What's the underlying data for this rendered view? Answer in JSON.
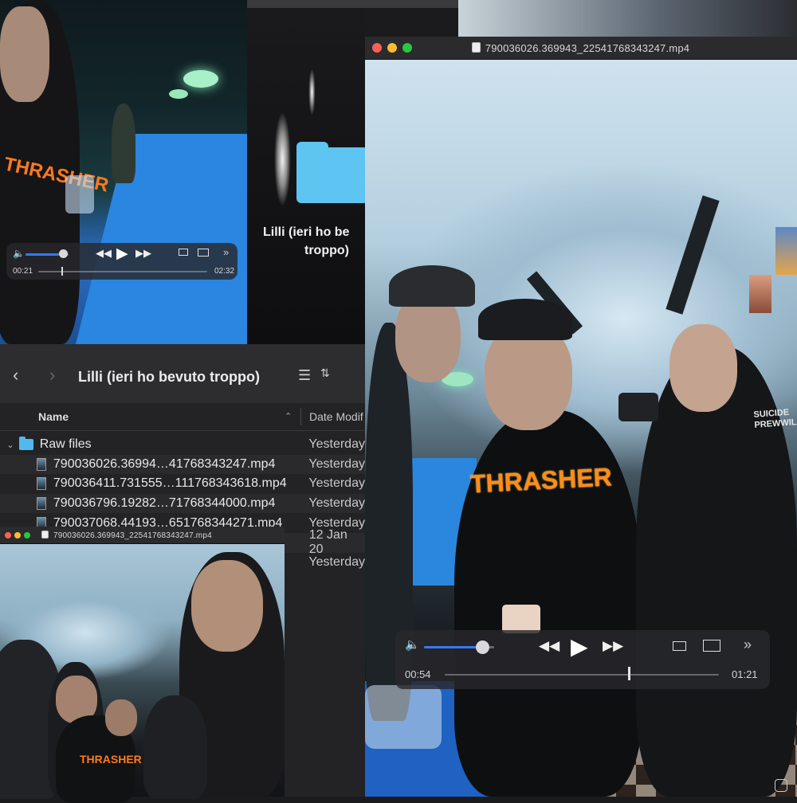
{
  "top_left_player": {
    "time_elapsed": "00:21",
    "time_total": "02:32",
    "volume_fraction": 0.75,
    "progress_fraction": 0.14
  },
  "folder_preview": {
    "name_line1": "Lilli (ieri ho be",
    "name_line2": "troppo)"
  },
  "finder": {
    "title": "Lilli (ieri ho bevuto troppo)",
    "columns": {
      "name": "Name",
      "date": "Date Modif"
    },
    "folder": {
      "name": "Raw files",
      "date": "Yesterday"
    },
    "files": [
      {
        "name": "790036026.36994…41768343247.mp4",
        "date": "Yesterday"
      },
      {
        "name": "790036411.731555…111768343618.mp4",
        "date": "Yesterday"
      },
      {
        "name": "790036796.19282…71768344000.mp4",
        "date": "Yesterday"
      },
      {
        "name": "790037068.44193…651768344271.mp4",
        "date": "Yesterday"
      }
    ],
    "extra_dates": [
      "12 Jan 20",
      "Yesterday"
    ]
  },
  "main_player": {
    "title": "790036026.369943_22541768343247.mp4",
    "time_elapsed": "00:54",
    "time_total": "01:21",
    "volume_fraction": 0.8,
    "progress_fraction": 0.67
  },
  "bottom_left_player": {
    "title": "790036026.369943_22541768343247.mp4"
  },
  "shirt_text": {
    "brand": "THRASHER",
    "other": "SUICIDE",
    "other2": "PREWWIL"
  },
  "colors": {
    "accent": "#3478f6",
    "folder": "#53b8f0"
  }
}
